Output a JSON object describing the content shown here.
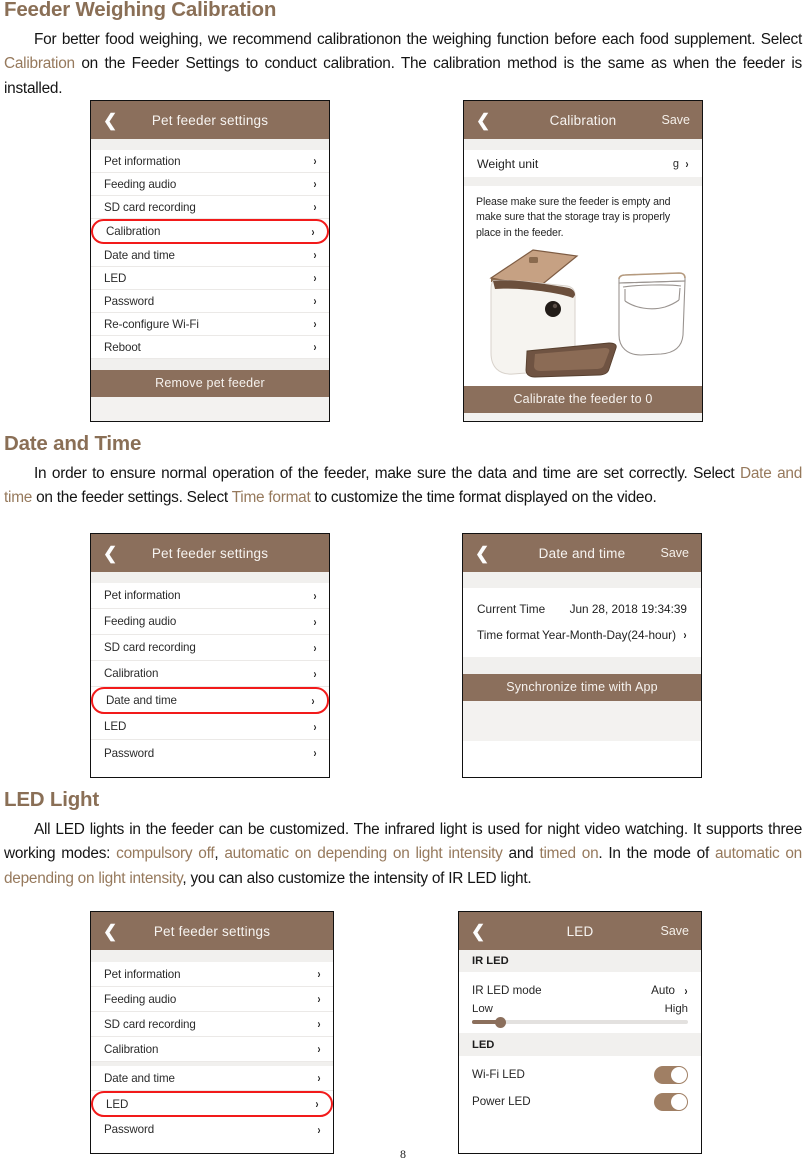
{
  "page": {
    "number": "8"
  },
  "sections": [
    {
      "heading": "Feeder Weighing Calibration",
      "paragraph_parts": [
        "For better food weighing, we recommend calibrationon the weighing function before each food supplement. Select ",
        "Calibration",
        " on the Feeder Settings to conduct calibration. The calibration method is the same as when the feeder is installed."
      ]
    },
    {
      "heading": "Date and Time",
      "paragraph_parts": [
        "In order to ensure normal operation of the feeder, make sure the data and time are set correctly. Select ",
        "Date and time",
        " on the feeder settings. Select ",
        "Time format",
        " to customize the time format displayed on the video."
      ]
    },
    {
      "heading": "LED Light",
      "paragraph_parts": [
        "All LED lights in the feeder can be customized. The infrared light is used for night video watching. It supports three working modes: ",
        "compulsory off",
        ", ",
        "automatic on depending on light intensity",
        " and ",
        "timed on",
        ". In the mode of ",
        "automatic on depending on light intensity",
        ", you can also customize the intensity of IR LED light."
      ]
    }
  ],
  "colors": {
    "heading": "#8a6f56",
    "keyword": "#96795c",
    "nav_bar": "#8b6f5c",
    "highlight_outline": "#f21a1a",
    "toggle_on": "#a07f64",
    "slider_active": "#8b6f5c"
  },
  "screens": {
    "settings_calibration": {
      "nav": {
        "back_icon": "chevron-left-icon",
        "title": "Pet feeder settings"
      },
      "items": [
        {
          "label": "Pet information",
          "chevron": "›",
          "highlighted": false
        },
        {
          "label": "Feeding audio",
          "chevron": "›",
          "highlighted": false
        },
        {
          "label": "SD card recording",
          "chevron": "›",
          "highlighted": false
        },
        {
          "label": "Calibration",
          "chevron": "›",
          "highlighted": true
        },
        {
          "label": "Date and time",
          "chevron": "›",
          "highlighted": false
        },
        {
          "label": "LED",
          "chevron": "›",
          "highlighted": false
        },
        {
          "label": "Password",
          "chevron": "›",
          "highlighted": false
        },
        {
          "label": "Re-configure Wi-Fi",
          "chevron": "›",
          "highlighted": false
        },
        {
          "label": "Reboot",
          "chevron": "›",
          "highlighted": false
        }
      ],
      "bottom_button": "Remove pet feeder"
    },
    "calibration": {
      "nav": {
        "back_icon": "chevron-left-icon",
        "title": "Calibration",
        "save": "Save"
      },
      "weight_unit_label": "Weight unit",
      "weight_unit_value": "g",
      "weight_unit_chevron": "›",
      "note": "Please make sure the feeder is empty and make sure that the storage tray is properly place in the feeder.",
      "illustration": "pet-feeder-and-tray-illustration",
      "bottom_button": "Calibrate the feeder to 0"
    },
    "settings_datetime": {
      "nav": {
        "back_icon": "chevron-left-icon",
        "title": "Pet feeder settings"
      },
      "items": [
        {
          "label": "Pet information",
          "chevron": "›",
          "highlighted": false
        },
        {
          "label": "Feeding audio",
          "chevron": "›",
          "highlighted": false
        },
        {
          "label": "SD card recording",
          "chevron": "›",
          "highlighted": false
        },
        {
          "label": "Calibration",
          "chevron": "›",
          "highlighted": false
        },
        {
          "label": "Date and time",
          "chevron": "›",
          "highlighted": true
        },
        {
          "label": "LED",
          "chevron": "›",
          "highlighted": false
        },
        {
          "label": "Password",
          "chevron": "›",
          "highlighted": false
        }
      ]
    },
    "datetime": {
      "nav": {
        "back_icon": "chevron-left-icon",
        "title": "Date and time",
        "save": "Save"
      },
      "current_time_label": "Current Time",
      "current_time_value": "Jun 28, 2018 19:34:39",
      "time_format_label": "Time format",
      "time_format_value": "Year-Month-Day(24-hour)",
      "time_format_chevron": "›",
      "sync_button": "Synchronize time with App"
    },
    "settings_led": {
      "nav": {
        "back_icon": "chevron-left-icon",
        "title": "Pet feeder settings"
      },
      "items": [
        {
          "label": "Pet information",
          "chevron": "›",
          "highlighted": false
        },
        {
          "label": "Feeding audio",
          "chevron": "›",
          "highlighted": false
        },
        {
          "label": "SD card recording",
          "chevron": "›",
          "highlighted": false
        },
        {
          "label": "Calibration",
          "chevron": "›",
          "highlighted": false
        },
        {
          "label": "Date and time",
          "chevron": "›",
          "highlighted": false
        },
        {
          "label": "LED",
          "chevron": "›",
          "highlighted": true
        },
        {
          "label": "Password",
          "chevron": "›",
          "highlighted": false
        }
      ]
    },
    "led": {
      "nav": {
        "back_icon": "chevron-left-icon",
        "title": "LED",
        "save": "Save"
      },
      "group_ir": "IR LED",
      "ir_mode_label": "IR LED mode",
      "ir_mode_value": "Auto",
      "ir_mode_chevron": "›",
      "slider_min_label": "Low",
      "slider_max_label": "High",
      "slider_value_percent": 13,
      "group_led": "LED",
      "wifi_led_label": "Wi-Fi LED",
      "wifi_led_state": "on",
      "power_led_label": "Power LED",
      "power_led_state": "on"
    }
  }
}
